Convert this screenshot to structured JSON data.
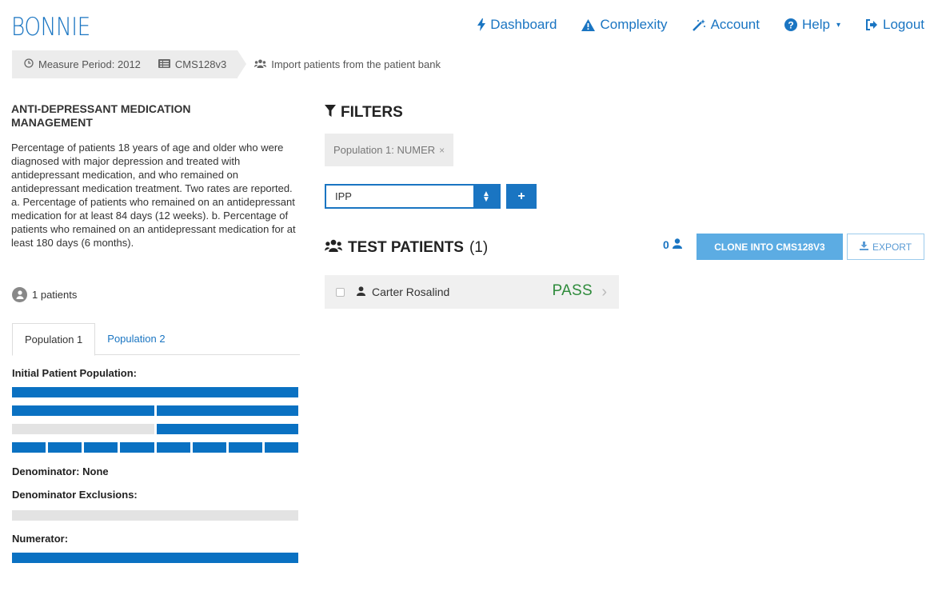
{
  "app": {
    "logo": "BONNIE"
  },
  "nav": [
    {
      "label": "Dashboard",
      "icon": "bolt-icon"
    },
    {
      "label": "Complexity",
      "icon": "warning-icon"
    },
    {
      "label": "Account",
      "icon": "magic-wand-icon"
    },
    {
      "label": "Help",
      "icon": "question-circle-icon",
      "caret": "▾"
    },
    {
      "label": "Logout",
      "icon": "sign-out-icon"
    }
  ],
  "breadcrumb": {
    "period": "Measure Period: 2012",
    "measure": "CMS128v3",
    "current": "Import patients from the patient bank"
  },
  "measure": {
    "title": "ANTI-DEPRESSANT MEDICATION MANAGEMENT",
    "description": "Percentage of patients 18 years of age and older who were diagnosed with major depression and treated with antidepressant medication, and who remained on antidepressant medication treatment. Two rates are reported. a. Percentage of patients who remained on an antidepressant medication for at least 84 days (12 weeks). b. Percentage of patients who remained on an antidepressant medication for at least 180 days (6 months).",
    "patients": "1 patients"
  },
  "tabs": [
    {
      "label": "Population 1",
      "active": true
    },
    {
      "label": "Population 2",
      "active": false
    }
  ],
  "population": {
    "ipp_label": "Initial Patient Population:",
    "denom_label": "Denominator: None",
    "denex_label": "Denominator Exclusions:",
    "numer_label": "Numerator:"
  },
  "filters": {
    "heading": "FILTERS",
    "chip": "Population 1: NUMER",
    "chip_close": "×",
    "select_value": "IPP",
    "add_label": "+"
  },
  "test_patients": {
    "heading": "TEST PATIENTS",
    "count": "(1)",
    "selected_count": "0",
    "clone_label": "CLONE INTO CMS128V3",
    "export_label": "EXPORT",
    "rows": [
      {
        "name": "Carter Rosalind",
        "status": "PASS"
      }
    ]
  },
  "colors": {
    "accent": "#1a75c2",
    "pass": "#2e8b3b",
    "clone": "#5cace3"
  }
}
